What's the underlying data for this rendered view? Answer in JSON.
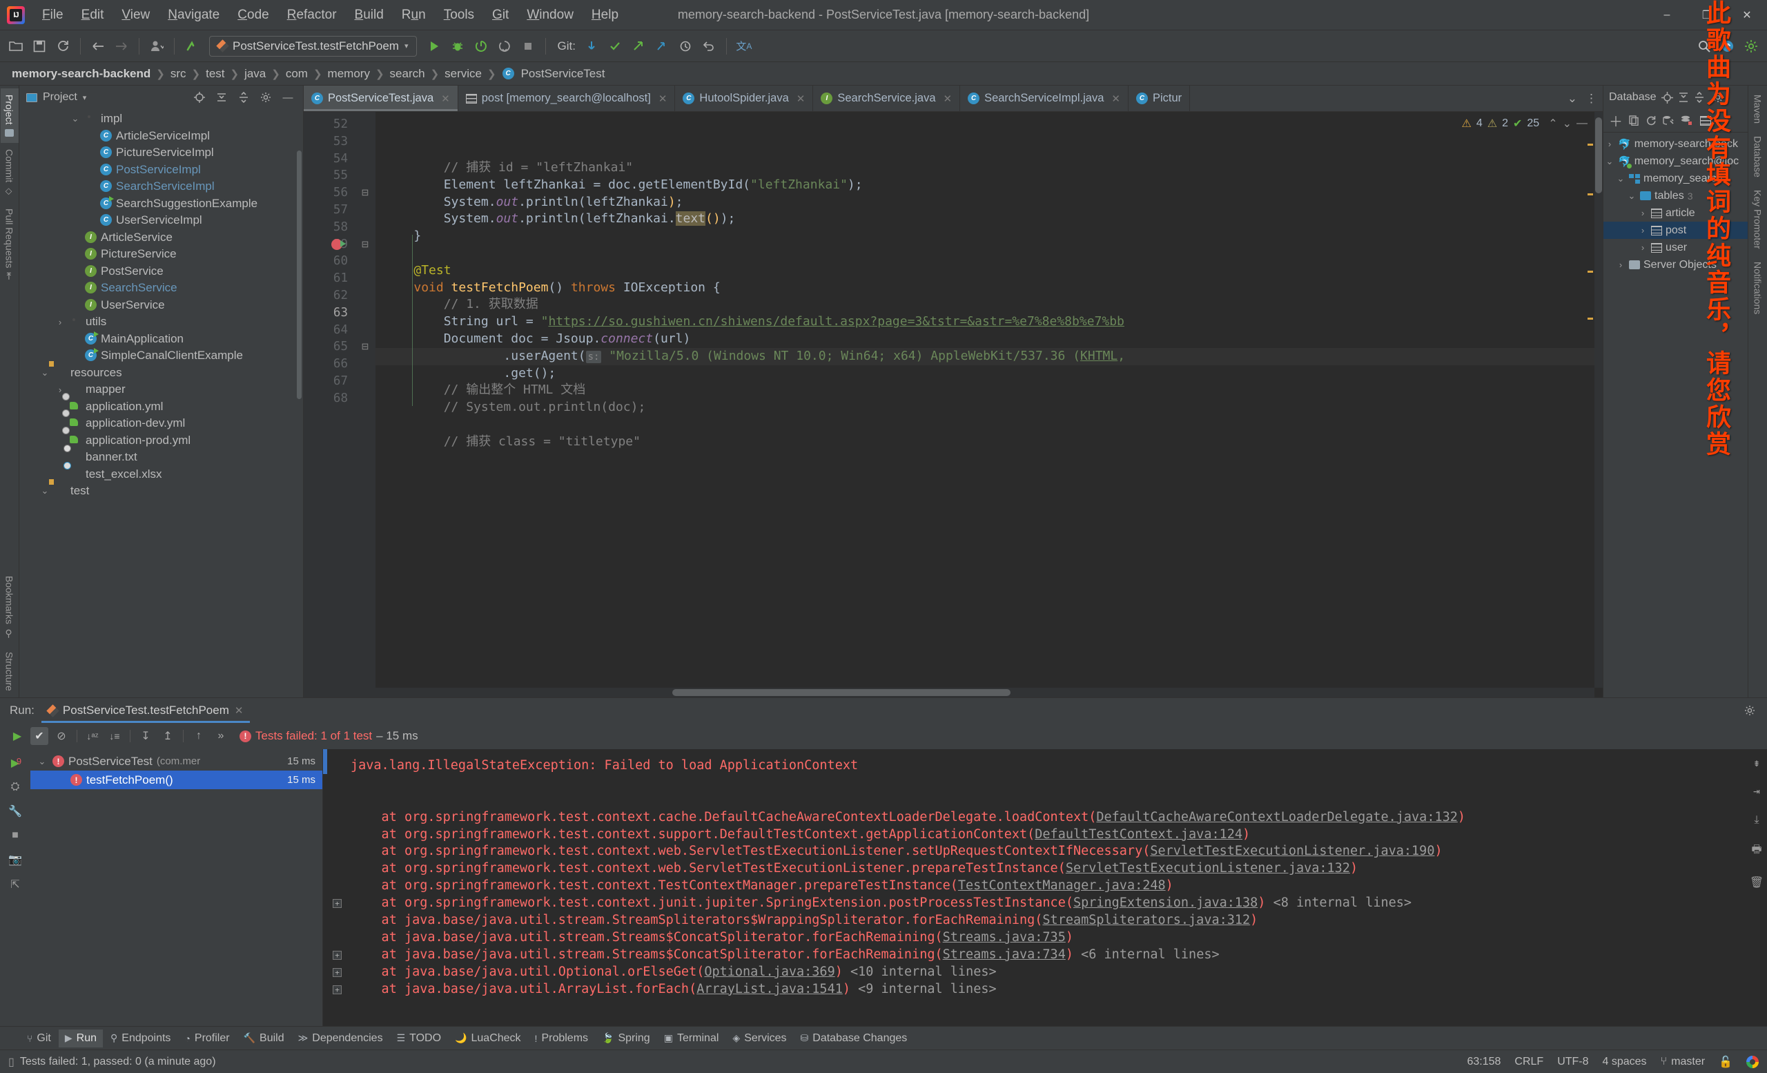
{
  "window": {
    "title": "memory-search-backend - PostServiceTest.java [memory-search-backend]",
    "minimize": "–",
    "maximize": "❐",
    "close": "✕"
  },
  "menubar": [
    {
      "label": "File"
    },
    {
      "label": "Edit"
    },
    {
      "label": "View"
    },
    {
      "label": "Navigate"
    },
    {
      "label": "Code"
    },
    {
      "label": "Refactor"
    },
    {
      "label": "Build"
    },
    {
      "label": "Run"
    },
    {
      "label": "Tools"
    },
    {
      "label": "Git"
    },
    {
      "label": "Window"
    },
    {
      "label": "Help"
    }
  ],
  "toolbar": {
    "open_icon": "📁",
    "save_icon": "💾",
    "sync_icon": "⟳",
    "back_icon": "←",
    "forward_icon": "→",
    "profile_icon": "👤",
    "updates_icon": "↖",
    "run_config": "PostServiceTest.testFetchPoem",
    "run_icon": "▶",
    "debug_icon": "🐞",
    "coverage_icon": "⥁",
    "more_run_icon": "⥁",
    "stop_icon": "■",
    "git_label": "Git:",
    "git_update_icon": "✓",
    "git_commit_icon": "✔",
    "git_push_icon": "↗",
    "git_branch_icon": "⎇",
    "git_history_icon": "⧖",
    "git_rollback_icon": "↶",
    "translate_icon": "文A",
    "search_icon": "🔍",
    "notif_icon": "↑",
    "settings_icon": "⚙"
  },
  "breadcrumb": {
    "items": [
      {
        "label": "memory-search-backend",
        "bold": true
      },
      {
        "label": "src"
      },
      {
        "label": "test"
      },
      {
        "label": "java"
      },
      {
        "label": "com"
      },
      {
        "label": "memory"
      },
      {
        "label": "search"
      },
      {
        "label": "service"
      },
      {
        "label": "PostServiceTest",
        "icon": "class"
      }
    ],
    "separator": "❯"
  },
  "left_rail": {
    "items": [
      {
        "label": "Project",
        "icon": "folder-icon",
        "active": true
      },
      {
        "label": "Commit",
        "icon": "commit-icon",
        "active": false
      },
      {
        "label": "Pull Requests",
        "icon": "pull-request-icon",
        "active": false
      }
    ],
    "bottom": [
      {
        "label": "Bookmarks",
        "icon": "bookmark-icon"
      },
      {
        "label": "Structure",
        "icon": "structure-icon"
      }
    ]
  },
  "project_panel": {
    "title": "Project",
    "dropdown_icon": "▾",
    "icons": [
      "target-icon",
      "collapse-all-icon",
      "expand-all-icon",
      "settings-icon",
      "hide-icon"
    ],
    "tree": [
      {
        "depth": 3,
        "arrow": "⌄",
        "icon": "folder",
        "label": "impl"
      },
      {
        "depth": 4,
        "arrow": "",
        "icon": "class",
        "label": "ArticleServiceImpl"
      },
      {
        "depth": 4,
        "arrow": "",
        "icon": "class",
        "label": "PictureServiceImpl"
      },
      {
        "depth": 4,
        "arrow": "",
        "icon": "class",
        "label": "PostServiceImpl",
        "blue": true
      },
      {
        "depth": 4,
        "arrow": "",
        "icon": "class",
        "label": "SearchServiceImpl",
        "blue": true
      },
      {
        "depth": 4,
        "arrow": "",
        "icon": "class-run",
        "label": "SearchSuggestionExample"
      },
      {
        "depth": 4,
        "arrow": "",
        "icon": "class",
        "label": "UserServiceImpl"
      },
      {
        "depth": 3,
        "arrow": "",
        "icon": "interface",
        "label": "ArticleService"
      },
      {
        "depth": 3,
        "arrow": "",
        "icon": "interface",
        "label": "PictureService"
      },
      {
        "depth": 3,
        "arrow": "",
        "icon": "interface",
        "label": "PostService"
      },
      {
        "depth": 3,
        "arrow": "",
        "icon": "interface",
        "label": "SearchService",
        "blue": true
      },
      {
        "depth": 3,
        "arrow": "",
        "icon": "interface",
        "label": "UserService"
      },
      {
        "depth": 2,
        "arrow": "›",
        "icon": "folder",
        "label": "utils"
      },
      {
        "depth": 3,
        "arrow": "",
        "icon": "class-run",
        "label": "MainApplication"
      },
      {
        "depth": 3,
        "arrow": "",
        "icon": "class-run",
        "label": "SimpleCanalClientExample"
      },
      {
        "depth": 1,
        "arrow": "⌄",
        "icon": "folder-res",
        "label": "resources"
      },
      {
        "depth": 2,
        "arrow": "›",
        "icon": "folder-plain",
        "label": "mapper"
      },
      {
        "depth": 2,
        "arrow": "",
        "icon": "yml",
        "label": "application.yml"
      },
      {
        "depth": 2,
        "arrow": "",
        "icon": "yml",
        "label": "application-dev.yml"
      },
      {
        "depth": 2,
        "arrow": "",
        "icon": "yml",
        "label": "application-prod.yml"
      },
      {
        "depth": 2,
        "arrow": "",
        "icon": "file",
        "label": "banner.txt"
      },
      {
        "depth": 2,
        "arrow": "",
        "icon": "file-xlsx",
        "label": "test_excel.xlsx"
      },
      {
        "depth": 1,
        "arrow": "⌄",
        "icon": "folder-test",
        "label": "test"
      }
    ]
  },
  "editor_tabs": [
    {
      "label": "PostServiceTest.java",
      "icon": "class",
      "active": true,
      "close": "✕"
    },
    {
      "label": "post [memory_search@localhost]",
      "icon": "table",
      "active": false,
      "close": "✕"
    },
    {
      "label": "HutoolSpider.java",
      "icon": "class",
      "active": false,
      "close": "✕"
    },
    {
      "label": "SearchService.java",
      "icon": "interface",
      "active": false,
      "close": "✕"
    },
    {
      "label": "SearchServiceImpl.java",
      "icon": "class",
      "active": false,
      "close": "✕"
    },
    {
      "label": "Pictur",
      "icon": "class",
      "active": false,
      "close": ""
    }
  ],
  "editor_tabbar_right": {
    "chevron": "⌄",
    "kebab": "⋮"
  },
  "inspection": {
    "warning_icon": "⚠",
    "warnings": "4",
    "weak_warning_icon": "⚠",
    "weak_warnings": "2",
    "ok_icon": "✔",
    "ok_count": "25",
    "up_icon": "⌃",
    "down_icon": "⌄",
    "hide_icon": "—"
  },
  "code": {
    "lines": [
      {
        "n": 52,
        "fold": "",
        "html": "        <span class='cmt'>// 捕获 id = \"leftZhankai\"</span>"
      },
      {
        "n": 53,
        "fold": "",
        "html": "        <span class='txt'>Element leftZhankai = doc.</span><span class='txt'>getElementById(</span><span class='str'>\"leftZhankai\"</span><span class='txt'>);</span>"
      },
      {
        "n": 54,
        "fold": "",
        "html": "        <span class='txt'>System.</span><span class='fld'>out</span><span class='txt'>.println(leftZhankai</span><span class='mth'>)</span><span class='txt'>;</span>"
      },
      {
        "n": 55,
        "fold": "",
        "html": "        <span class='txt'>System.</span><span class='fld'>out</span><span class='txt'>.println(leftZhankai.</span><span class='hl'>text</span><span class='mth'>()</span><span class='txt'>);</span>"
      },
      {
        "n": 56,
        "fold": "⊟",
        "html": "    <span class='txt'>}</span>"
      },
      {
        "n": 57,
        "fold": "",
        "html": ""
      },
      {
        "n": 58,
        "fold": "",
        "html": "    <span class='ann'>@Test</span>"
      },
      {
        "n": 59,
        "fold": "⊟",
        "breakpoint": true,
        "cur": false,
        "html": "    <span class='kw'>void </span><span class='mth'>testFetchPoem</span><span class='txt'>() </span><span class='kw'>throws </span><span class='txt'>IOException {</span>"
      },
      {
        "n": 60,
        "fold": "",
        "html": "        <span class='cmt'>// 1. 获取数据</span>"
      },
      {
        "n": 61,
        "fold": "",
        "html": "        <span class='txt'>String url = </span><span class='str'>\"</span><span class='link'>https://so.gushiwen.cn/shiwens/default.aspx?page=3&amp;tstr=&amp;astr=%e7%8e%8b%e7%bb</span>"
      },
      {
        "n": 62,
        "fold": "",
        "html": "        <span class='txt'>Document doc = Jsoup.</span><span class='fld'>connect</span><span class='txt'>(url)</span>"
      },
      {
        "n": 63,
        "fold": "",
        "cur": true,
        "html": "                <span class='txt'>.userAgent(</span><span class='hint'>s:</span><span class='str'> \"Mozilla/5.0 (Windows NT 10.0; Win64; x64) AppleWebKit/537.36 (</span><span class='link'>KHTML</span><span class='str'>,</span>"
      },
      {
        "n": 64,
        "fold": "",
        "html": "                <span class='txt'>.get();</span>"
      },
      {
        "n": 65,
        "fold": "⊟",
        "html": "        <span class='cmt'>// 输出整个 HTML 文档</span>"
      },
      {
        "n": 66,
        "fold": "",
        "html": "        <span class='cmt'>// System.out.println(doc);</span>"
      },
      {
        "n": 67,
        "fold": "",
        "html": ""
      },
      {
        "n": 68,
        "fold": "",
        "html": "        <span class='cmt'>// 捕获 class = \"titletype\"</span>"
      }
    ]
  },
  "db_panel": {
    "title": "Database",
    "head_icons": [
      "locate-icon",
      "collapse-icon",
      "expand-icon",
      "settings-icon"
    ],
    "toolbar_icons": [
      "add-icon",
      "copy-icon",
      "refresh-icon",
      "run-sql-icon",
      "db-sync-icon",
      "table-icon"
    ],
    "tree": [
      {
        "depth": 0,
        "arrow": "›",
        "icon": "dolphin",
        "label": "memory-search-back"
      },
      {
        "depth": 0,
        "arrow": "⌄",
        "icon": "dolphin-green",
        "label": "memory_search@loc"
      },
      {
        "depth": 1,
        "arrow": "⌄",
        "icon": "schema",
        "label": "memory_search"
      },
      {
        "depth": 2,
        "arrow": "⌄",
        "icon": "folder",
        "label": "tables",
        "count": "3"
      },
      {
        "depth": 3,
        "arrow": "›",
        "icon": "table",
        "label": "article"
      },
      {
        "depth": 3,
        "arrow": "›",
        "icon": "table",
        "label": "post",
        "selected": true
      },
      {
        "depth": 3,
        "arrow": "›",
        "icon": "table",
        "label": "user"
      },
      {
        "depth": 1,
        "arrow": "›",
        "icon": "folder-grey",
        "label": "Server Objects"
      }
    ]
  },
  "right_rail": {
    "items": [
      {
        "label": "Maven",
        "icon": "maven-icon"
      },
      {
        "label": "Database",
        "icon": "database-icon"
      },
      {
        "label": "Key Promoter",
        "icon": "key-icon"
      },
      {
        "label": "Notifications",
        "icon": "bell-icon"
      }
    ]
  },
  "run_panel": {
    "run_label": "Run:",
    "tab_label": "PostServiceTest.testFetchPoem",
    "tab_close": "✕",
    "toolbar": {
      "rerun_icon": "▶",
      "show_passed_icon": "✔",
      "hide_ignored_icon": "⊘",
      "sort_alpha_icon": "↓aᴢ",
      "sort_duration_icon": "↓≡",
      "expand_icon": "↧",
      "collapse_icon": "↥",
      "prev_icon": "↑",
      "next_icon": "»",
      "status_icon": "!",
      "status_main": "Tests failed: 1 of 1 test",
      "status_sub": "– 15 ms"
    },
    "side_rail_icons": [
      "rerun-icon",
      "debug-icon",
      "wrench-icon",
      "stop-icon",
      "camera-icon",
      "export-icon",
      "print-icon"
    ],
    "tree": [
      {
        "depth": 0,
        "arrow": "⌄",
        "label": "PostServiceTest",
        "sub": "(com.mer",
        "time": "15 ms",
        "selected": false
      },
      {
        "depth": 1,
        "arrow": "",
        "label": "testFetchPoem()",
        "sub": "",
        "time": "15 ms",
        "selected": true
      }
    ],
    "console": [
      {
        "text": "java.lang.IllegalStateException: Failed to load ApplicationContext",
        "indent": 0,
        "type": "header"
      },
      {
        "text": "",
        "indent": 0,
        "type": "blank"
      },
      {
        "text": "",
        "indent": 0,
        "type": "blank"
      },
      {
        "prefix": "    at org.springframework.test.context.cache.DefaultCacheAwareContextLoaderDelegate.loadContext(",
        "ref": "DefaultCacheAwareContextLoaderDelegate.java:132",
        "suffix": ")",
        "type": "frame"
      },
      {
        "prefix": "    at org.springframework.test.context.support.DefaultTestContext.getApplicationContext(",
        "ref": "DefaultTestContext.java:124",
        "suffix": ")",
        "type": "frame"
      },
      {
        "prefix": "    at org.springframework.test.context.web.ServletTestExecutionListener.setUpRequestContextIfNecessary(",
        "ref": "ServletTestExecutionListener.java:190",
        "suffix": ")",
        "type": "frame"
      },
      {
        "prefix": "    at org.springframework.test.context.web.ServletTestExecutionListener.prepareTestInstance(",
        "ref": "ServletTestExecutionListener.java:132",
        "suffix": ")",
        "type": "frame"
      },
      {
        "prefix": "    at org.springframework.test.context.TestContextManager.prepareTestInstance(",
        "ref": "TestContextManager.java:248",
        "suffix": ")",
        "type": "frame"
      },
      {
        "prefix": "    at org.springframework.test.context.junit.jupiter.SpringExtension.postProcessTestInstance(",
        "ref": "SpringExtension.java:138",
        "suffix": ")",
        "internal": "<8 internal lines>",
        "expander": true,
        "type": "frame"
      },
      {
        "prefix": "    at java.base/java.util.stream.StreamSpliterators$WrappingSpliterator.forEachRemaining(",
        "ref": "StreamSpliterators.java:312",
        "suffix": ")",
        "type": "frame"
      },
      {
        "prefix": "    at java.base/java.util.stream.Streams$ConcatSpliterator.forEachRemaining(",
        "ref": "Streams.java:735",
        "suffix": ")",
        "type": "frame"
      },
      {
        "prefix": "    at java.base/java.util.stream.Streams$ConcatSpliterator.forEachRemaining(",
        "ref": "Streams.java:734",
        "suffix": ")",
        "internal": "<6 internal lines>",
        "expander": true,
        "type": "frame"
      },
      {
        "prefix": "    at java.base/java.util.Optional.orElseGet(",
        "ref": "Optional.java:369",
        "suffix": ")",
        "internal": "<10 internal lines>",
        "expander": true,
        "type": "frame"
      },
      {
        "prefix": "    at java.base/java.util.ArrayList.forEach(",
        "ref": "ArrayList.java:1541",
        "suffix": ")",
        "internal": "<9 internal lines>",
        "expander": true,
        "type": "frame"
      }
    ]
  },
  "bottom_bar": [
    {
      "label": "Git",
      "icon": "git-icon",
      "active": false
    },
    {
      "label": "Run",
      "icon": "run-icon",
      "active": true
    },
    {
      "label": "Endpoints",
      "icon": "endpoints-icon",
      "active": false
    },
    {
      "label": "Profiler",
      "icon": "profiler-icon",
      "active": false
    },
    {
      "label": "Build",
      "icon": "build-icon",
      "active": false
    },
    {
      "label": "Dependencies",
      "icon": "dependencies-icon",
      "active": false
    },
    {
      "label": "TODO",
      "icon": "todo-icon",
      "active": false
    },
    {
      "label": "LuaCheck",
      "icon": "luacheck-icon",
      "active": false
    },
    {
      "label": "Problems",
      "icon": "problems-icon",
      "active": false
    },
    {
      "label": "Spring",
      "icon": "spring-icon",
      "active": false
    },
    {
      "label": "Terminal",
      "icon": "terminal-icon",
      "active": false
    },
    {
      "label": "Services",
      "icon": "services-icon",
      "active": false
    },
    {
      "label": "Database Changes",
      "icon": "database-changes-icon",
      "active": false
    }
  ],
  "status_bar": {
    "message_icon": "□",
    "message": "Tests failed: 1, passed: 0 (a minute ago)",
    "caret": "63:158",
    "line_sep": "CRLF",
    "encoding": "UTF-8",
    "indent": "4 spaces",
    "branch_icon": "⎇",
    "branch": "master",
    "lock_icon": "🔓",
    "google_icon": "google-icon"
  },
  "watermark": {
    "text": "此歌曲为没有填词的纯音乐，请您欣赏"
  }
}
